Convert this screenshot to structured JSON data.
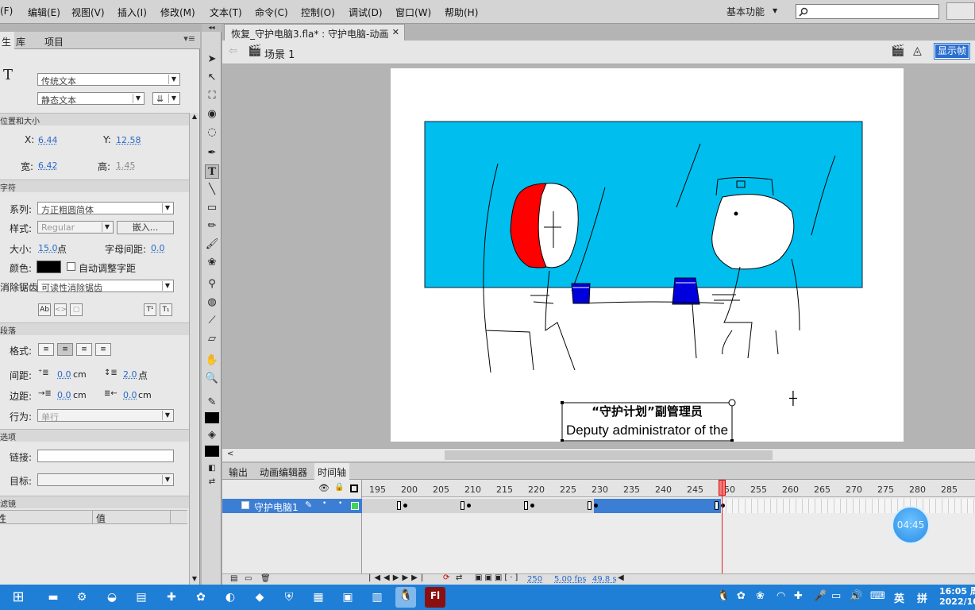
{
  "menu": [
    "(F)",
    "编辑(E)",
    "视图(V)",
    "插入(I)",
    "修改(M)",
    "文本(T)",
    "命令(C)",
    "控制(O)",
    "调试(D)",
    "窗口(W)",
    "帮助(H)"
  ],
  "menu_first_partial": "(F)",
  "workspace_label": "基本功能",
  "search_placeholder": "",
  "left_panel": {
    "tabs": [
      "生",
      "库",
      "项目"
    ],
    "text_tool_icon": "T",
    "text_type": "传统文本",
    "text_subtype": "静态文本",
    "section_position": "位置和大小",
    "x_label": "X:",
    "x_value": "6.44",
    "y_label": "Y:",
    "y_value": "12.58",
    "w_label": "宽:",
    "w_value": "6.42",
    "h_label": "高:",
    "h_value": "1.45",
    "section_char": "字符",
    "family_label": "系列:",
    "family_value": "方正粗圆简体",
    "style_label": "样式:",
    "style_value": "Regular",
    "embed_button": "嵌入...",
    "size_label": "大小:",
    "size_value": "15.0",
    "size_unit": "点",
    "spacing_label": "字母间距:",
    "spacing_value": "0.0",
    "color_label": "颜色:",
    "auto_kern_label": "自动调整字距",
    "aa_label": "消除锯齿:",
    "aa_value": "可读性消除锯齿",
    "section_para": "段落",
    "format_label": "格式:",
    "gap_label": "间距:",
    "gap_value": "0.0",
    "gap_unit": "cm",
    "leading_value": "2.0",
    "leading_unit": "点",
    "margin_label": "边距:",
    "margin_left_value": "0.0",
    "margin_left_unit": "cm",
    "margin_right_value": "0.0",
    "margin_right_unit": "cm",
    "behavior_label": "行为:",
    "behavior_value": "单行",
    "section_options": "选项",
    "link_label": "链接:",
    "target_label": "目标:",
    "section_filters": "滤镜",
    "filter_col_property": "性",
    "filter_col_value": "值"
  },
  "document": {
    "tab_title": "恢复_守护电脑3.fla* : 守护电脑-动画",
    "scene_label": "场景 1",
    "show_frame_button": "显示帧",
    "caption_line1": "“守护计划”副管理员",
    "caption_line2": "Deputy administrator of the"
  },
  "bottom_tabs": [
    "输出",
    "动画编辑器",
    "时间轴"
  ],
  "timeline": {
    "layer_name": "守护电脑1",
    "ruler": [
      "195",
      "200",
      "205",
      "210",
      "215",
      "220",
      "225",
      "230",
      "235",
      "240",
      "245",
      "250",
      "255",
      "260",
      "265",
      "270",
      "275",
      "280",
      "285"
    ],
    "current_frame": "250",
    "fps": "5.00 fps",
    "time": "49.8 s"
  },
  "overlay_timer": "04:45",
  "taskbar": {
    "ime_label": "英",
    "ime_mode": "拼",
    "clock_time": "16:05",
    "clock_time_suffix": "周",
    "clock_date": "2022/10"
  },
  "colors": {
    "stage_background_fill": "#00bfef",
    "red_face": "#ff0000",
    "blue_cup": "#0000dd",
    "layer_selected": "#3b7ed4",
    "taskbar": "#1f7fd6",
    "playhead": "#e02020"
  }
}
